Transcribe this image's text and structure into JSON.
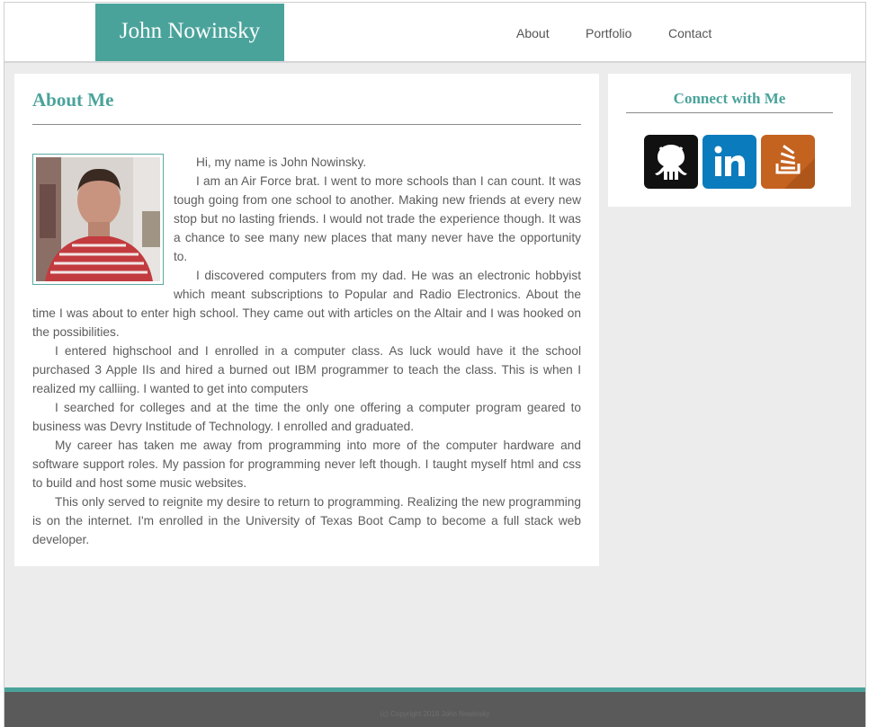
{
  "header": {
    "brand": "John Nowinsky",
    "nav": [
      "About",
      "Portfolio",
      "Contact"
    ]
  },
  "main": {
    "title": "About Me",
    "photo_icon": "profile-photo",
    "paragraphs": [
      "Hi, my name is John Nowinsky.",
      "I am an Air Force brat. I went to more schools than I can count. It was tough going from one school to another. Making new friends at every new stop but no lasting friends. I would not trade the experience though. It was a chance to see many new places that many never have the opportunity to.",
      "I discovered computers from my dad. He was an electronic hobbyist which meant subscriptions to Popular and Radio Electronics. About the time I was about to enter high school. They came out with articles on the Altair and I was hooked on the possibilities.",
      "I entered highschool and I enrolled in a computer class. As luck would have it the school purchased 3 Apple IIs and hired a burned out IBM programmer to teach the class. This is when I realized my calliing. I wanted to get into computers",
      "I searched for colleges and at the time the only one offering a computer program geared to business was Devry Institude of Technology. I enrolled and graduated.",
      "My career has taken me away from programming into more of the computer hardware and software support roles. My passion for programming never left though. I taught myself html and css to build and host some music websites.",
      "This only served to reignite my desire to return to programming. Realizing the new programming is on the internet. I'm enrolled in the University of Texas Boot Camp to become a full stack web developer."
    ]
  },
  "sidebar": {
    "title": "Connect with Me",
    "social": [
      {
        "name": "github-icon",
        "color": "#111111"
      },
      {
        "name": "linkedin-icon",
        "color": "#0a7bbc"
      },
      {
        "name": "stackoverflow-icon",
        "color": "#c4621f"
      }
    ]
  },
  "footer": {
    "text": "(c) Copyright 2016 John Nowinsky"
  },
  "colors": {
    "accent": "#4aa39b",
    "background": "#ececec",
    "footer": "#5a5a5a"
  }
}
